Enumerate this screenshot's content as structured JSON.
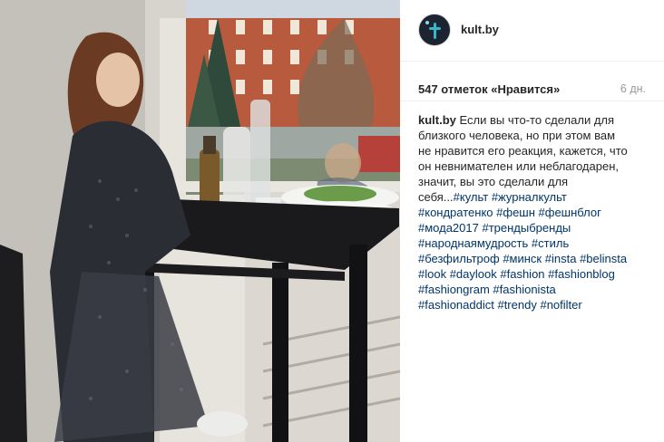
{
  "post": {
    "username": "kult.by",
    "likes": "547 отметок «Нравится»",
    "time_ago": "6 дн.",
    "caption": {
      "author": "kult.by",
      "lines": [
        "Если вы что-то сделали для",
        "близкого человека, но при этом вам",
        "не нравится его реакция, кажется, что",
        "он невнимателен или неблагодарен,",
        "значит, вы это сделали для",
        "себя..."
      ],
      "tags_rows": [
        [
          "#культ",
          "#журналкульт"
        ],
        [
          "#кондратенко",
          "#фешн",
          "#фешнблог"
        ],
        [
          "#мода2017",
          "#трендыбренды"
        ],
        [
          "#народнаямудрость",
          "#стиль"
        ],
        [
          "#безфильтроф",
          "#минск",
          "#insta",
          "#belinsta"
        ],
        [
          "#look",
          "#daylook",
          "#fashion",
          "#fashionblog"
        ],
        [
          "#fashiongram",
          "#fashionista"
        ],
        [
          "#fashionaddict",
          "#trendy",
          "#nofilter"
        ]
      ]
    }
  },
  "colors": {
    "text": "#262626",
    "hashtag": "#003569",
    "muted": "#999999",
    "divider": "#efefef"
  },
  "icons": {
    "avatar": "kult-logo-avatar"
  }
}
